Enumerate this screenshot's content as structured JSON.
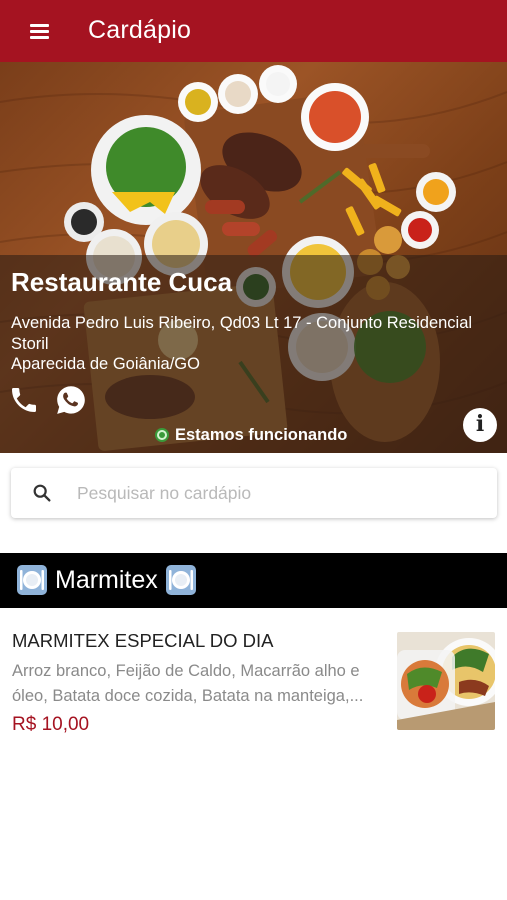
{
  "appbar": {
    "title": "Cardápio",
    "menu_icon": "hamburger-menu-icon"
  },
  "restaurant": {
    "name": "Restaurante Cuca",
    "address_line1": "Avenida Pedro Luis Ribeiro, Qd03 Lt 17 - Conjunto Residencial",
    "address_line2": "Storil",
    "city": "Aparecida de Goiânia/GO",
    "status": "Estamos funcionando",
    "status_color": "#3a9a3a",
    "icons": [
      "phone-icon",
      "whatsapp-icon",
      "info-icon"
    ]
  },
  "search": {
    "placeholder": "Pesquisar no cardápio",
    "value": ""
  },
  "categories": [
    {
      "title": "Marmitex",
      "icon": "plate-cutlery-icon",
      "items": [
        {
          "title": "MARMITEX ESPECIAL DO DIA",
          "description_line1": "Arroz branco, Feijão de Caldo, Macarrão alho e",
          "description_line2": "óleo, Batata doce cozida, Batata na manteiga,...",
          "price": "R$ 10,00"
        }
      ]
    }
  ],
  "colors": {
    "brand": "#a51321",
    "category_bar": "#000000",
    "price": "#a51321"
  }
}
